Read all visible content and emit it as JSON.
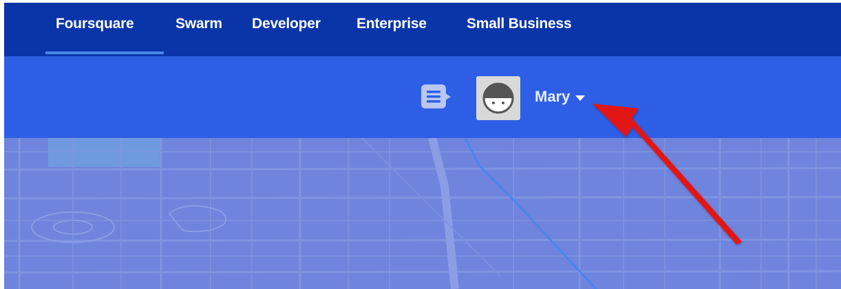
{
  "topnav": {
    "items": [
      {
        "label": "Foursquare",
        "active": true
      },
      {
        "label": "Swarm"
      },
      {
        "label": "Developer"
      },
      {
        "label": "Enterprise"
      },
      {
        "label": "Small Business"
      }
    ]
  },
  "header": {
    "notification_icon": "message-icon",
    "avatar_icon": "default-face-avatar",
    "user": {
      "name": "Mary",
      "menu_icon": "caret-down-icon"
    }
  },
  "colors": {
    "topnav_bg": "#0a35a8",
    "header_bg": "#2e5ee5",
    "map_bg": "#6e84dd",
    "annotation_arrow": "#e31414"
  }
}
